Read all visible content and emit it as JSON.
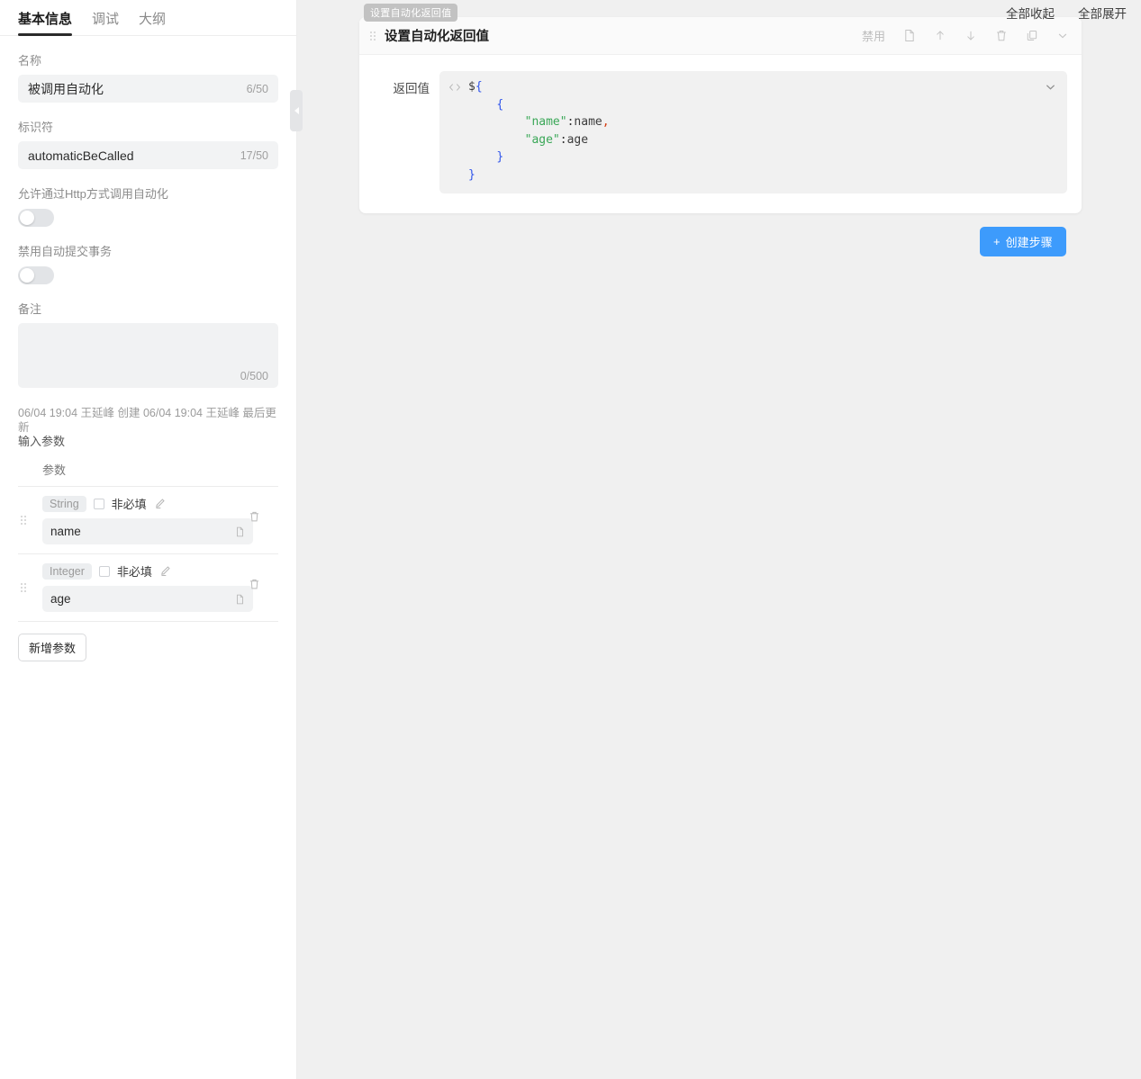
{
  "sidebar": {
    "tabs": [
      {
        "label": "基本信息",
        "active": true
      },
      {
        "label": "调试",
        "active": false
      },
      {
        "label": "大纲",
        "active": false
      }
    ],
    "name_field": {
      "label": "名称",
      "value": "被调用自动化",
      "counter": "6/50"
    },
    "ident_field": {
      "label": "标识符",
      "value": "automaticBeCalled",
      "counter": "17/50"
    },
    "http_toggle": {
      "label": "允许通过Http方式调用自动化",
      "on": false
    },
    "commit_toggle": {
      "label": "禁用自动提交事务",
      "on": false
    },
    "remark": {
      "label": "备注",
      "value": "",
      "counter": "0/500"
    },
    "meta": "06/04 19:04 王延峰 创建 06/04 19:04 王延峰 最后更新",
    "input_params_title": "输入参数",
    "param_column_header": "参数",
    "params": [
      {
        "type": "String",
        "required_label": "非必填",
        "checked": false,
        "value": "name"
      },
      {
        "type": "Integer",
        "required_label": "非必填",
        "checked": false,
        "value": "age"
      }
    ],
    "add_param_label": "新增参数"
  },
  "canvas": {
    "collapse_all_label": "全部收起",
    "expand_all_label": "全部展开",
    "create_step_label": "创建步骤",
    "create_step_plus": "+",
    "step": {
      "tooltip": "设置自动化返回值",
      "title": "设置自动化返回值",
      "disable_label": "禁用",
      "body_label": "返回值",
      "code_lines": [
        {
          "indent": 0,
          "tokens": [
            {
              "t": "$",
              "c": "tk-plain"
            },
            {
              "t": "{",
              "c": "tk-brace"
            }
          ]
        },
        {
          "indent": 1,
          "tokens": [
            {
              "t": "{",
              "c": "tk-brace"
            }
          ]
        },
        {
          "indent": 2,
          "tokens": [
            {
              "t": "\"name\"",
              "c": "tk-str"
            },
            {
              "t": ":",
              "c": "tk-punc"
            },
            {
              "t": "name",
              "c": "tk-plain"
            },
            {
              "t": ",",
              "c": "tk-comma"
            }
          ]
        },
        {
          "indent": 2,
          "tokens": [
            {
              "t": "\"age\"",
              "c": "tk-str"
            },
            {
              "t": ":",
              "c": "tk-punc"
            },
            {
              "t": "age",
              "c": "tk-plain"
            }
          ]
        },
        {
          "indent": 1,
          "tokens": [
            {
              "t": "}",
              "c": "tk-brace"
            }
          ]
        },
        {
          "indent": 0,
          "tokens": [
            {
              "t": "}",
              "c": "tk-brace"
            }
          ]
        }
      ]
    }
  },
  "colors": {
    "accent_blue": "#3d9bfc",
    "code_string": "#3aa757",
    "code_brace": "#2f54eb",
    "code_comma": "#d4380d",
    "canvas_bg": "#f0f0f0"
  }
}
